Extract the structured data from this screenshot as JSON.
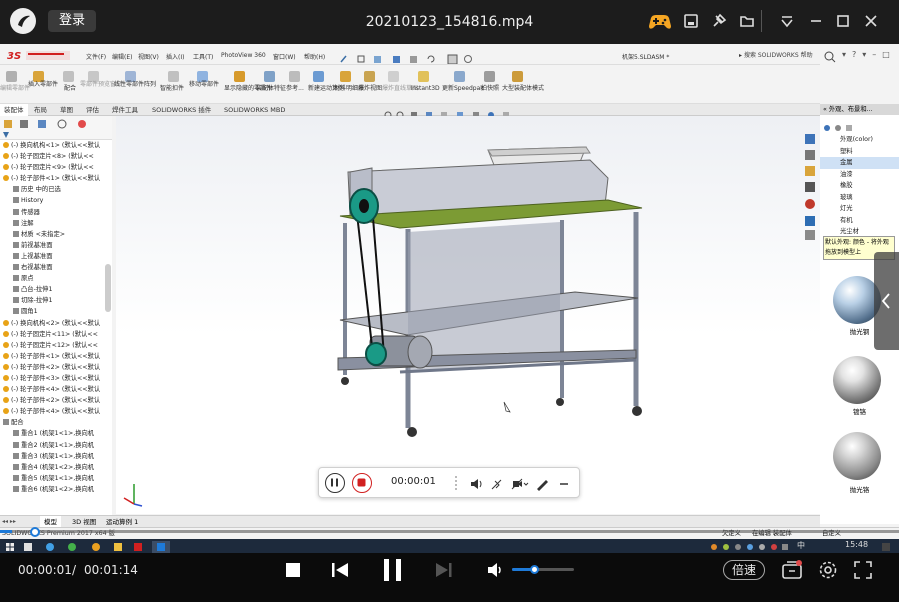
{
  "player": {
    "login_label": "登录",
    "file_title": "20210123_154816.mp4",
    "current_time": "00:00:01",
    "separator": "/",
    "total_time": "00:01:14",
    "speed_label": "倍速",
    "volume_level": 0.35,
    "progress_fraction": 0.013
  },
  "solidworks": {
    "menus": [
      "文件(F)",
      "编辑(E)",
      "视图(V)",
      "插入(I)",
      "工具(T)",
      "PhotoView 360",
      "窗口(W)",
      "帮助(H)"
    ],
    "doc_title": "机架5.SLDASM *",
    "help_search": "搜索 SOLIDWORKS 帮助",
    "toolbar_items": [
      "编辑零部件",
      "插入零部件",
      "配合",
      "零部件预览窗口",
      "线性零部件阵列",
      "智能扣件",
      "移动零部件",
      "显示隐藏的零部件",
      "装配体特征",
      "参考...",
      "新建运动算例",
      "材料明细表",
      "爆炸视图",
      "爆炸直线草图",
      "Instant3D",
      "更新Speedpak",
      "拍快照",
      "大型装配体模式"
    ],
    "command_tabs": [
      "装配体",
      "布局",
      "草图",
      "评估",
      "焊件工具",
      "SOLIDWORKS 插件",
      "SOLIDWORKS MBD"
    ],
    "tree_items": [
      "(-) 换向机构<1> (默认<<默认",
      "(-) 轮子固定片<8> (默认<<",
      "(-) 轮子固定片<9> (默认<<",
      "(-) 轮子部件<1> (默认<<默认",
      "历史 中的已选",
      "History",
      "传感器",
      "注解",
      "材质 <未指定>",
      "前视基准面",
      "上视基准面",
      "右视基准面",
      "原点",
      "凸台-拉伸1",
      "切除-拉伸1",
      "圆角1",
      "(-) 换向机构<2> (默认<<默认",
      "(-) 轮子固定片<11> (默认<<",
      "(-) 轮子固定片<12> (默认<<",
      "(-) 轮子部件<1> (默认<<默认",
      "(-) 轮子部件<2> (默认<<默认",
      "(-) 轮子部件<3> (默认<<默认",
      "(-) 轮子部件<4> (默认<<默认",
      "(-) 轮子部件<2> (默认<<默认",
      "(-) 轮子部件<4> (默认<<默认",
      "配合",
      "重合1 (机架1<1>,换向机",
      "重合2 (机架1<1>,换向机",
      "重合3 (机架1<1>,换向机",
      "重合4 (机架1<2>,换向机",
      "重合5 (机架1<1>,换向机",
      "重合6 (机架1<2>,换向机"
    ],
    "bottom_tabs": [
      "模型",
      "3D 视图",
      "运动算例 1"
    ],
    "status_left": "SOLIDWORKS Premium 2017 x64 版",
    "status_items": [
      "欠定义",
      "在编辑 装配体",
      "自定义"
    ],
    "panel_header": "« 外观、布景和...",
    "panel_items": [
      "外观(color)",
      "塑料",
      "金属",
      "油漆",
      "橡胶",
      "玻璃",
      "灯光",
      "有机",
      "光尘材"
    ],
    "panel_tooltip": "默认外观: 颜色 - 将外观拖放到模型上",
    "materials": [
      "抛光钢",
      "镀铬",
      "抛光铬"
    ]
  },
  "taskbar": {
    "tray": [
      "中",
      "15:48"
    ]
  },
  "colors": {
    "player_bg": "#1c1c1c",
    "accent_blue": "#1e7ad8",
    "sw_red": "#d12020",
    "belt_wheel": "#1a9a86",
    "tabletop": "#7c9b34"
  }
}
